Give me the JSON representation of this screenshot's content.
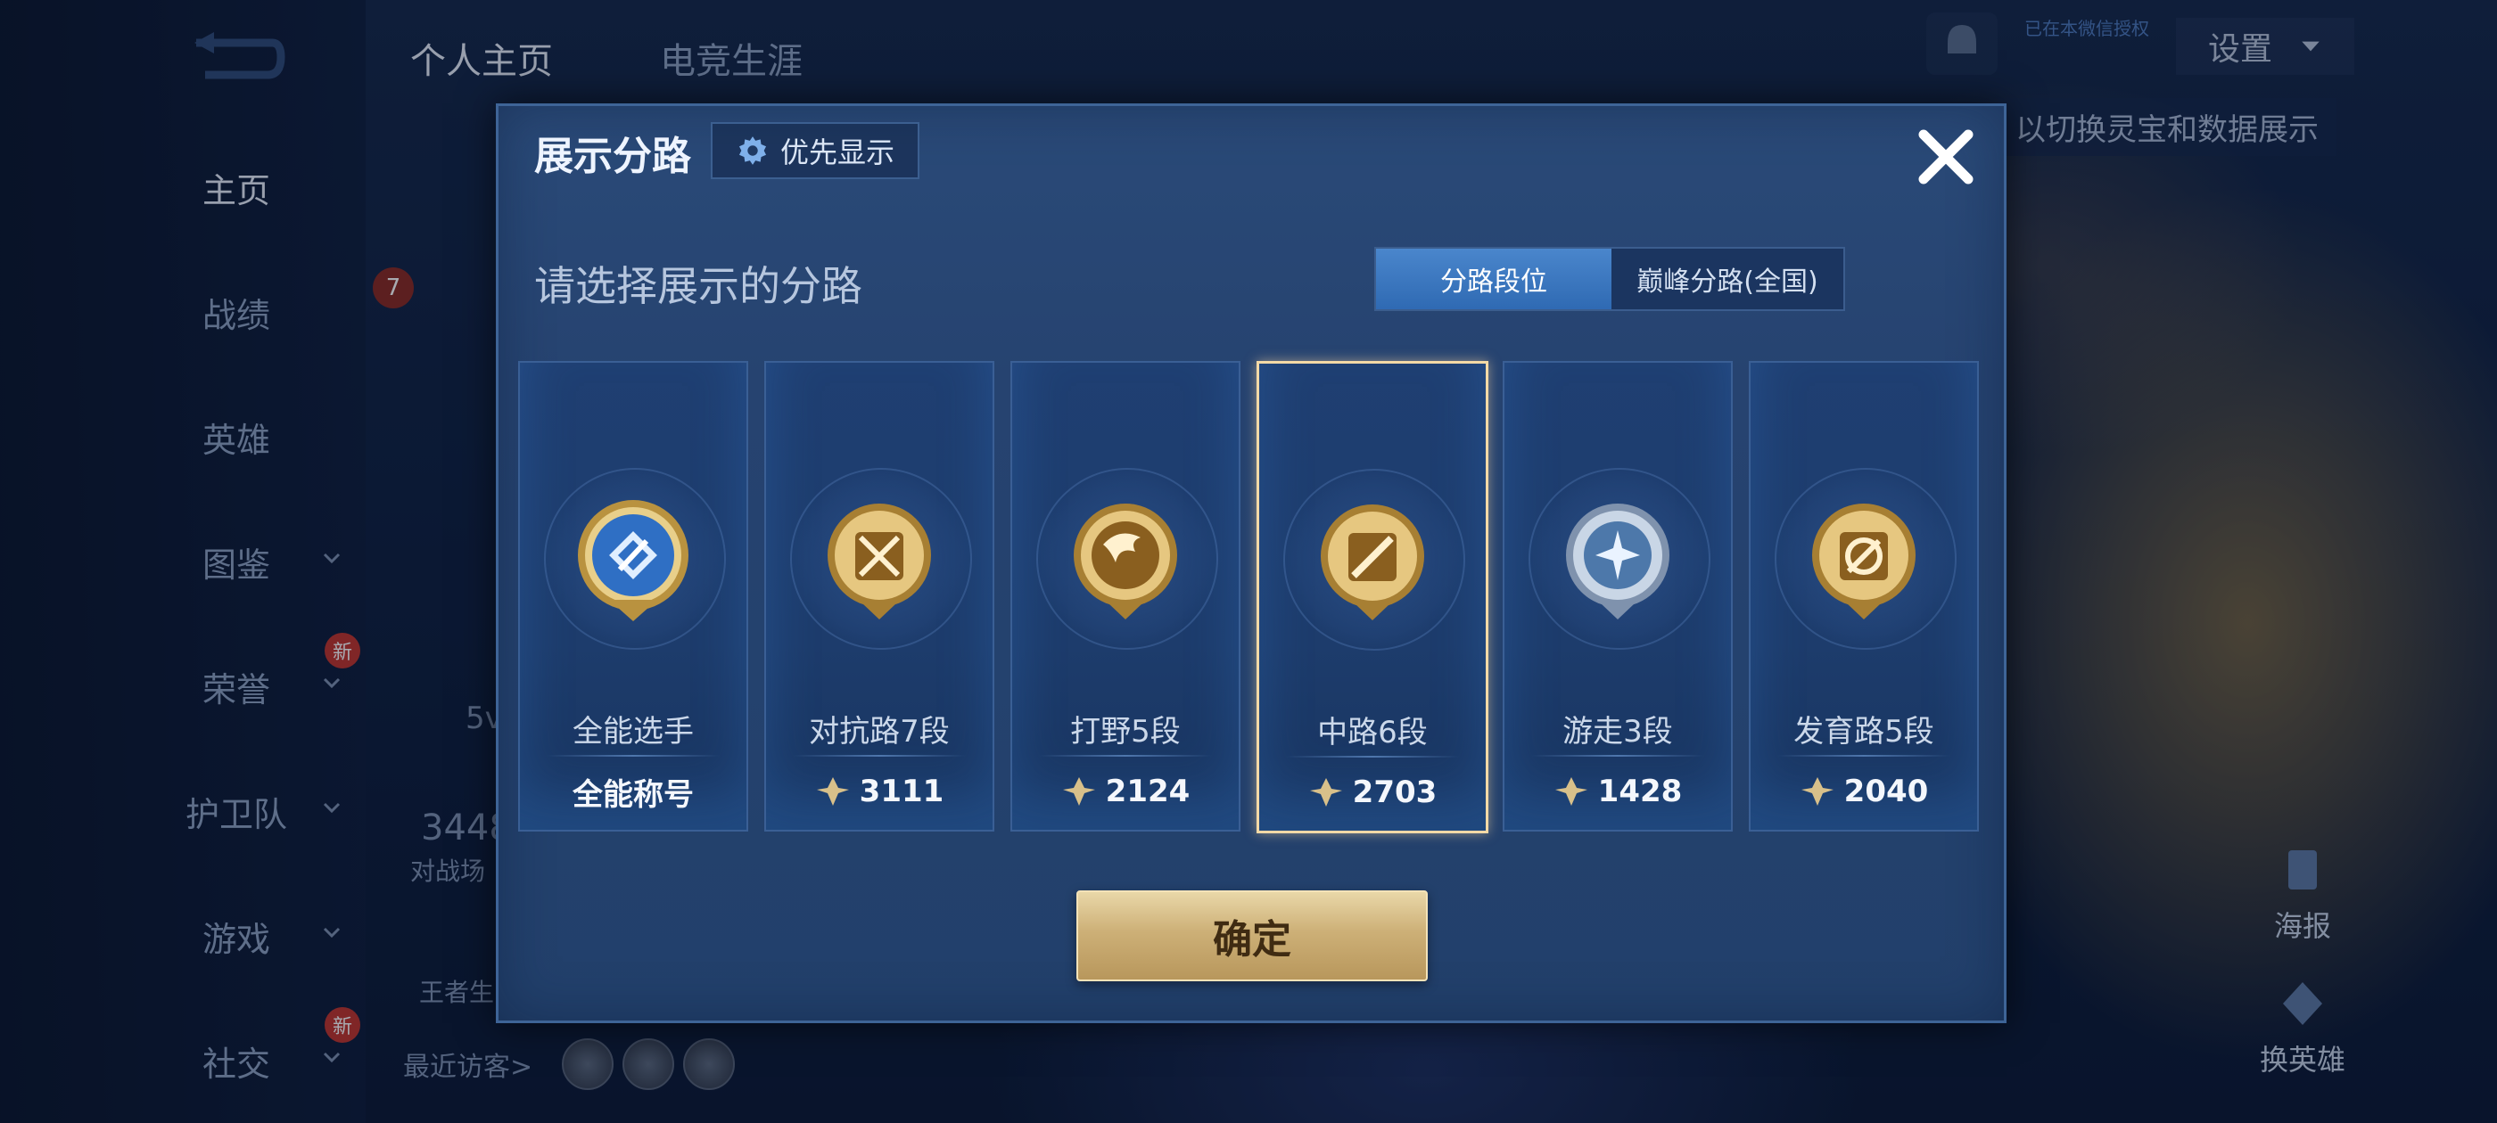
{
  "background": {
    "nav": [
      {
        "label": "主页",
        "active": true
      },
      {
        "label": "战绩"
      },
      {
        "label": "英雄"
      },
      {
        "label": "图鉴"
      },
      {
        "label": "荣誉"
      },
      {
        "label": "护卫队"
      },
      {
        "label": "游戏"
      },
      {
        "label": "社交"
      }
    ],
    "new_badge": "新",
    "top_tabs": [
      "个人主页",
      "电竞生涯"
    ],
    "settings_label": "设置",
    "small_tag": "已在本微信授权",
    "hint": "以切换灵宝和数据展示",
    "stat_value": "3448",
    "stat_label": "对战场",
    "stat_5v": "5v",
    "king_label": "王者生",
    "visitors_label": "最近访客>",
    "poster_label": "海报",
    "change_hero_label": "换英雄",
    "level_badge": "7"
  },
  "dialog": {
    "title": "展示分路",
    "priority_button": "优先显示",
    "subtitle": "请选择展示的分路",
    "toggle": [
      "分路段位",
      "巅峰分路(全国)"
    ],
    "lanes": [
      {
        "name": "全能选手",
        "score": "全能称号",
        "icon": "all-round-emblem-icon"
      },
      {
        "name": "对抗路7段",
        "score": "3111",
        "icon": "clash-lane-emblem-icon"
      },
      {
        "name": "打野5段",
        "score": "2124",
        "icon": "jungle-emblem-icon"
      },
      {
        "name": "中路6段",
        "score": "2703",
        "icon": "mid-lane-emblem-icon",
        "selected": true
      },
      {
        "name": "游走3段",
        "score": "1428",
        "icon": "roam-emblem-icon"
      },
      {
        "name": "发育路5段",
        "score": "2040",
        "icon": "farm-lane-emblem-icon"
      }
    ],
    "confirm": "确定"
  },
  "colors": {
    "dialog_bg": "#264370",
    "gold": "#cdb077",
    "toggle_active": "#3f78c0",
    "selected_border": "#f3d9a6"
  }
}
